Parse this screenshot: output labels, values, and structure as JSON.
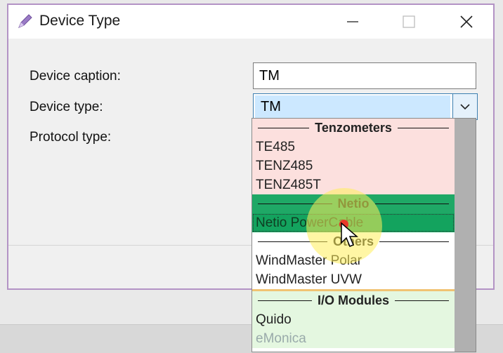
{
  "window": {
    "title": "Device Type",
    "icon": "pen-icon"
  },
  "form": {
    "device_caption_label": "Device caption:",
    "device_caption_value": "TM",
    "device_type_label": "Device type:",
    "device_type_value": "TM",
    "protocol_type_label": "Protocol type:"
  },
  "dropdown": {
    "groups": [
      {
        "header": "Tenzometers",
        "color": "#fce0de",
        "items": [
          "TE485",
          "TENZ485",
          "TENZ485T"
        ]
      },
      {
        "header": "Netio",
        "color": "#1fa866",
        "items": [
          "Netio PowerCable"
        ]
      },
      {
        "header": "Others",
        "color": "#ffffff",
        "items": [
          "WindMaster Polar",
          "WindMaster UVW"
        ]
      },
      {
        "header": "I/O Modules",
        "color": "#e4f7e0",
        "items": [
          "Quido",
          "eMonica"
        ]
      }
    ],
    "selected_item": "Netio PowerCable"
  },
  "colors": {
    "window_border": "#b393c5",
    "select_highlight": "#cce8ff",
    "selected_row": "#13a35e"
  }
}
